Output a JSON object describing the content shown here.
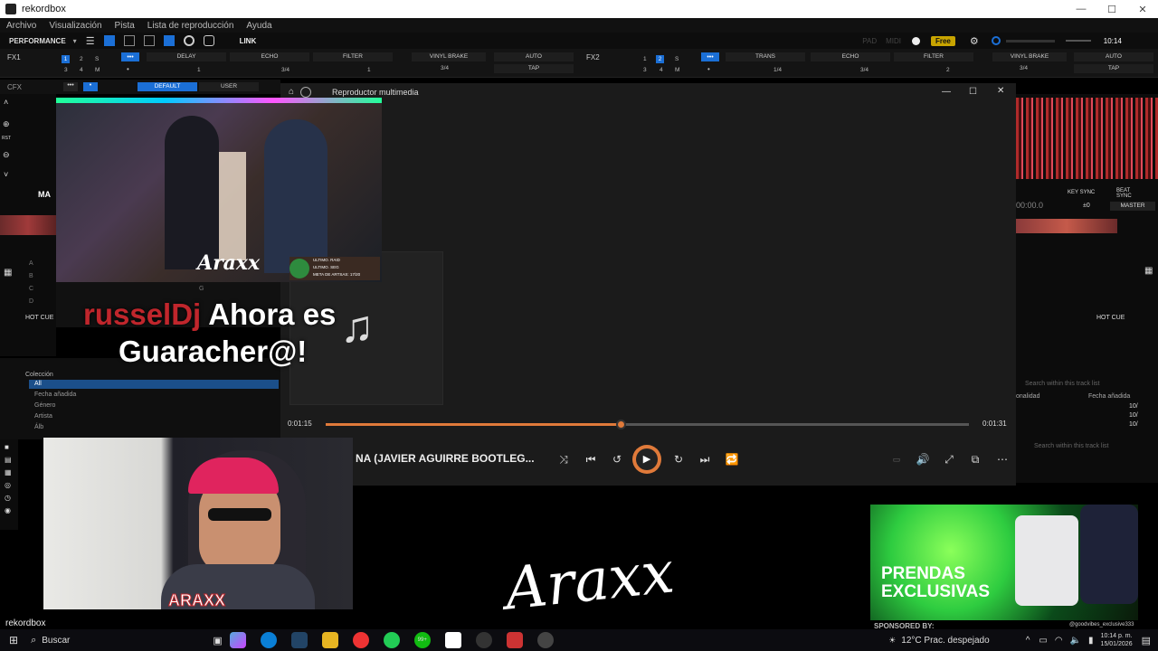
{
  "window": {
    "title": "rekordbox",
    "min": "—",
    "max": "☐",
    "close": "✕"
  },
  "menu": [
    "Archivo",
    "Visualización",
    "Pista",
    "Lista de reproducción",
    "Ayuda"
  ],
  "toolbar": {
    "mode": "PERFORMANCE",
    "link": "LINK",
    "pad": "PAD",
    "midi": "MIDI",
    "plan": "Free",
    "clock": "10:14"
  },
  "fx1": {
    "label": "FX1",
    "nums": [
      "1",
      "2",
      "S",
      "3",
      "4",
      "M"
    ],
    "slots": [
      {
        "name": "DELAY",
        "beat": "1"
      },
      {
        "name": "ECHO",
        "beat": "3/4"
      },
      {
        "name": "FILTER",
        "beat": "1"
      }
    ],
    "brake": "VINYL BRAKE",
    "brake_beat": "3/4",
    "auto": "AUTO",
    "tap": "TAP"
  },
  "fx2": {
    "label": "FX2",
    "nums": [
      "1",
      "2",
      "S",
      "3",
      "4",
      "M"
    ],
    "slots": [
      {
        "name": "TRANS",
        "beat": "1/4"
      },
      {
        "name": "ECHO",
        "beat": "3/4"
      },
      {
        "name": "FILTER",
        "beat": "2"
      }
    ],
    "brake": "VINYL BRAKE",
    "brake_beat": "3/4",
    "auto": "AUTO",
    "tap": "TAP"
  },
  "cfx": {
    "label": "CFX",
    "default": "DEFAULT",
    "user": "USER"
  },
  "left_panel": {
    "rst": "RST",
    "mark": "MA",
    "hot_cue": "HOT CUE",
    "cues": [
      "A",
      "B",
      "C",
      "D",
      "G"
    ]
  },
  "right_panel": {
    "time": "00:00.0",
    "key_sync": "KEY SYNC",
    "beat_sync": "BEAT SYNC",
    "pm": "±0",
    "master": "MASTER",
    "hot_cue": "HOT CUE",
    "search1": "Search within this track list",
    "search2": "Search within this track list",
    "col_key": "onalidad",
    "col_date": "Fecha añadida",
    "rows": [
      "10/",
      "10/",
      "10/"
    ]
  },
  "library": {
    "collection": "Colección",
    "items": [
      "All",
      "Fecha añadida",
      "Género",
      "Artista",
      "Álb"
    ]
  },
  "player": {
    "app_title": "Reproductor multimedia",
    "elapsed": "0:01:15",
    "total": "0:01:31",
    "progress": 0.46,
    "track_title": "NA (JAVIER AGUIRRE BOOTLEG..."
  },
  "overlays": {
    "alert_name": "russelDj",
    "alert_text_1": "Ahora es",
    "alert_text_2": "Guaracher@!",
    "video_logo": "Araxx",
    "video_badge_lines": [
      "ULTIMO. RAID",
      "ULTIMO. SEG",
      "META DE ARTSAS: 17/20"
    ],
    "brand_logo": "Araxx",
    "webcam_badge": "ARAXX",
    "promo_line1": "PRENDAS",
    "promo_line2": "EXCLUSIVAS",
    "sponsored": "SPONSORED BY:",
    "handle": "@goodvibes_exclusive333",
    "rb_logo": "rekordbox"
  },
  "taskbar": {
    "search": "Buscar",
    "weather": "12°C  Prac. despejado",
    "time": "10:14 p. m.",
    "date": "15/01/2026",
    "badge": "99+"
  },
  "colors": {
    "accent": "#1b6fd6",
    "seek": "#e07a3a",
    "alert_name": "#c0262c",
    "promo": "#2ecc40"
  }
}
